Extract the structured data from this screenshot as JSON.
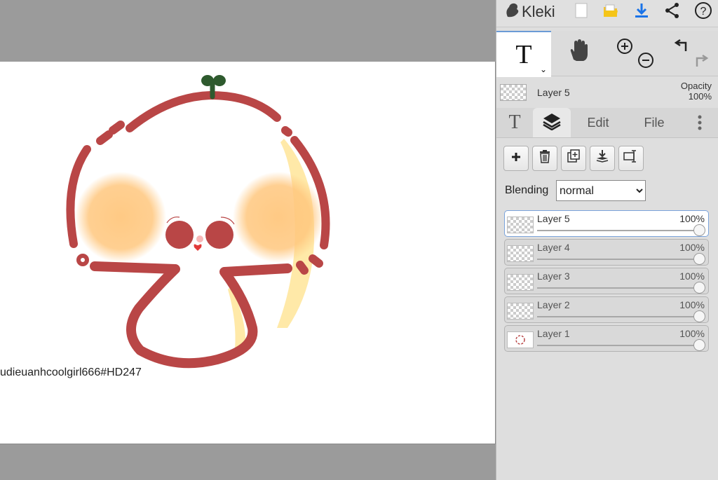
{
  "app": {
    "name": "Kleki"
  },
  "topbar": {
    "icons": [
      "new-image-icon",
      "open-folder-icon",
      "download-icon",
      "share-icon",
      "help-icon"
    ]
  },
  "tools": {
    "active": "text-tool",
    "items": [
      "text-tool",
      "hand-tool",
      "zoom-in",
      "zoom-out",
      "undo",
      "redo"
    ]
  },
  "current_layer": {
    "name": "Layer 5",
    "opacity_label": "Opacity",
    "opacity_value": "100%"
  },
  "tabs": {
    "items": [
      "T",
      "layers",
      "Edit",
      "File"
    ],
    "active": "layers",
    "edit": "Edit",
    "file": "File"
  },
  "layer_tools": [
    "add-layer",
    "delete-layer",
    "duplicate-layer",
    "merge-layer-down",
    "rename-layer"
  ],
  "blending": {
    "label": "Blending",
    "value": "normal"
  },
  "layers": [
    {
      "name": "Layer 5",
      "opacity": "100%",
      "opacity_fraction": 1.0,
      "selected": true
    },
    {
      "name": "Layer 4",
      "opacity": "100%",
      "opacity_fraction": 1.0,
      "selected": false
    },
    {
      "name": "Layer 3",
      "opacity": "100%",
      "opacity_fraction": 1.0,
      "selected": false
    },
    {
      "name": "Layer 2",
      "opacity": "100%",
      "opacity_fraction": 1.0,
      "selected": false
    },
    {
      "name": "Layer 1",
      "opacity": "100%",
      "opacity_fraction": 1.0,
      "selected": false
    }
  ],
  "canvas": {
    "signature": "udieuanhcoolgirl666#HD247"
  },
  "colors": {
    "outline": "#b94646",
    "blush": "#ffc77e",
    "highlight": "#ffe9a8",
    "sprout": "#2e5a2e",
    "accent": "#1a73e8",
    "background": "#9b9b9b",
    "panel": "#dedede"
  }
}
